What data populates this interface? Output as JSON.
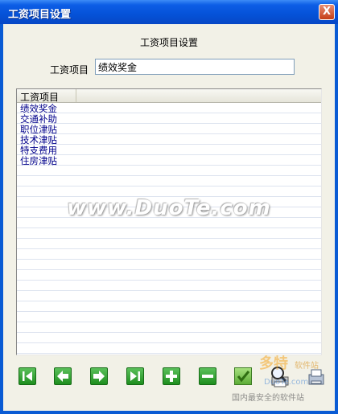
{
  "window": {
    "title": "工资项目设置",
    "close_glyph": "X"
  },
  "form": {
    "heading": "工资项目设置",
    "field_label": "工资项目",
    "field_value": "绩效奖金"
  },
  "list": {
    "column_header": "工资项目",
    "items": [
      "绩效奖金",
      "交通补助",
      "职位津贴",
      "技术津贴",
      "特支费用",
      "住房津贴"
    ]
  },
  "toolbar": {
    "buttons": [
      "first-record",
      "previous-record",
      "next-record",
      "last-record",
      "add",
      "delete",
      "confirm",
      "print",
      "fax"
    ]
  },
  "watermark": {
    "text": "www.DuoTe.com"
  },
  "logo": {
    "name": "多特",
    "subtitle": "软件站",
    "url": "DuoTe.com",
    "tagline": "国内最安全的软件站"
  },
  "colors": {
    "titlebar": "#0552d8",
    "window_bg": "#f2f1e7",
    "button_green": "#1e8e1e",
    "list_text": "#00008b"
  }
}
